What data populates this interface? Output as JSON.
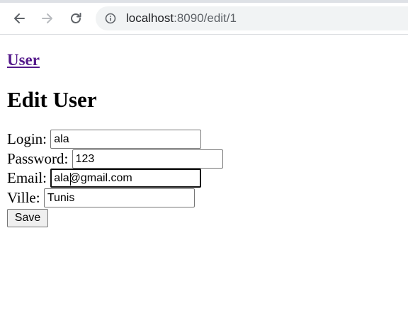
{
  "browser": {
    "url_host": "localhost",
    "url_rest": ":8090/edit/1",
    "back_icon": "arrow-left-icon",
    "forward_icon": "arrow-right-icon",
    "reload_icon": "reload-icon",
    "info_icon": "info-circle-icon"
  },
  "page": {
    "nav_link": "User",
    "title": "Edit User",
    "form": {
      "login_label": "Login:",
      "login_value": "ala",
      "password_label": "Password:",
      "password_value": "123",
      "email_label": "Email:",
      "email_value": "ala@gmail.com",
      "ville_label": "Ville:",
      "ville_value": "Tunis",
      "save_label": "Save"
    }
  },
  "colors": {
    "link_visited": "#551a8b",
    "omnibox_bg": "#f1f3f4",
    "button_bg": "#efefef"
  }
}
